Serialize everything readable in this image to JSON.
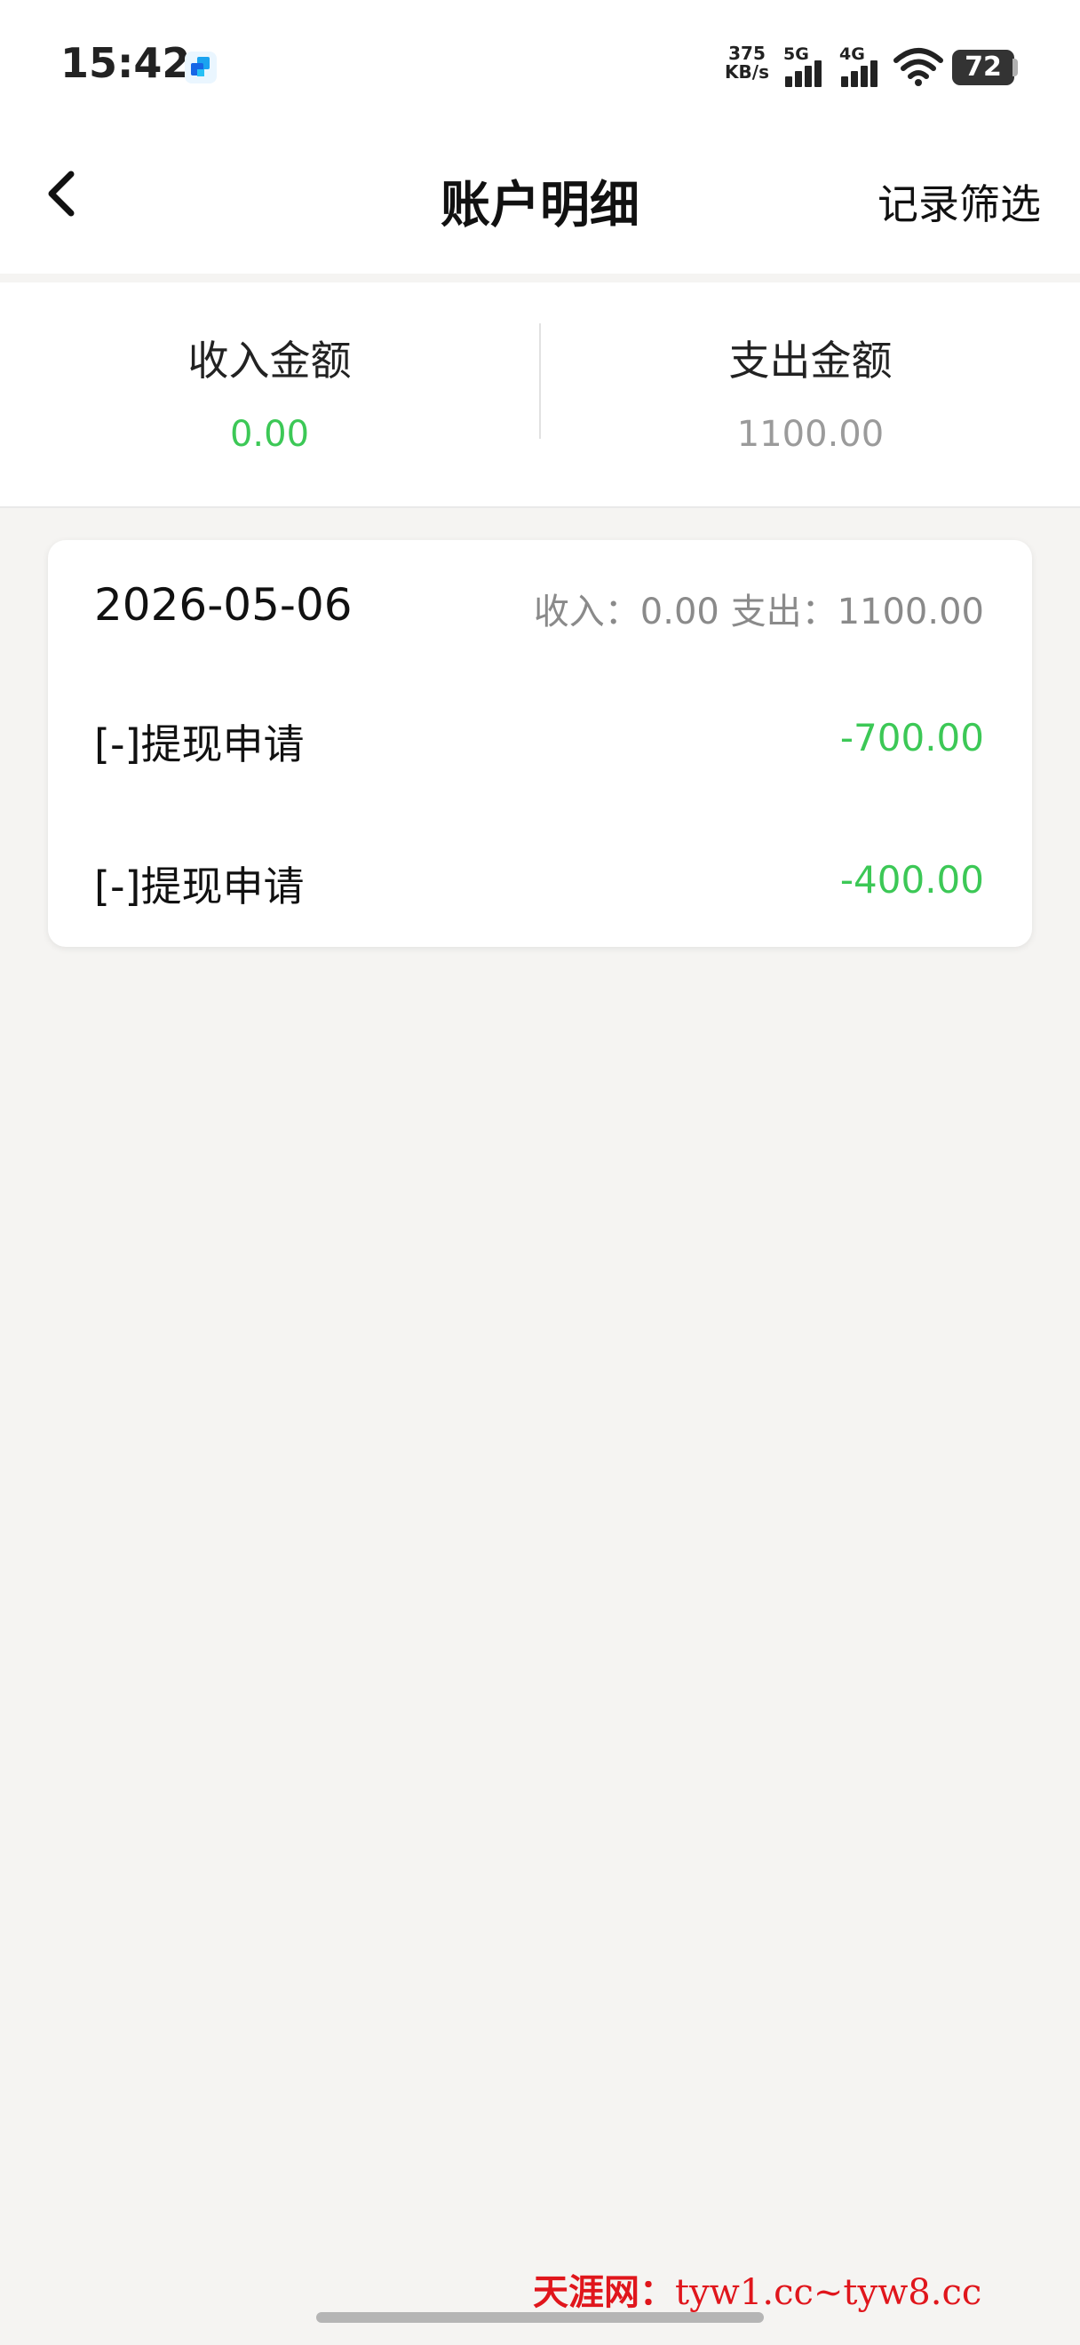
{
  "status_bar": {
    "time": "15:42",
    "net_speed_value": "375",
    "net_speed_unit": "KB/s",
    "signal_1_label": "5G",
    "signal_2_label": "4G",
    "battery": "72",
    "icons": [
      "app-notification-icon",
      "signal-5g-icon",
      "signal-4g-icon",
      "wifi-icon",
      "battery-icon"
    ]
  },
  "header": {
    "title": "账户明细",
    "filter_label": "记录筛选",
    "back_icon": "chevron-left-icon"
  },
  "summary": {
    "income_label": "收入金额",
    "income_value": "0.00",
    "expense_label": "支出金额",
    "expense_value": "1100.00"
  },
  "records": {
    "date": "2026-05-06",
    "day_summary": "收入：0.00 支出：1100.00",
    "items": [
      {
        "title": "[-]提现申请",
        "amount": "-700.00"
      },
      {
        "title": "[-]提现申请",
        "amount": "-400.00"
      }
    ]
  },
  "watermark": {
    "cn": "天涯网：",
    "url": "tyw1.cc~tyw8.cc"
  },
  "colors": {
    "income_green": "#3cc856",
    "muted_gray": "#8a8a8a",
    "page_bg": "#f5f4f2",
    "watermark_red": "#e0161c"
  }
}
